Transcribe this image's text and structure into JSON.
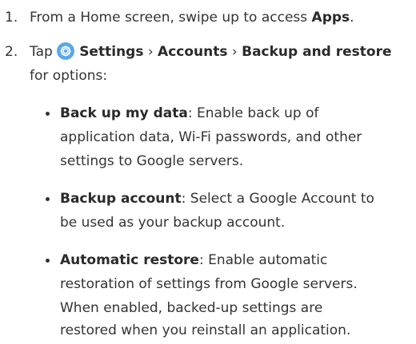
{
  "steps": [
    {
      "number": "1.",
      "text_before": "From a Home screen, swipe up to access ",
      "bold": "Apps",
      "text_after": "."
    },
    {
      "number": "2.",
      "tap": "Tap ",
      "path": [
        {
          "label": "Settings",
          "icon": "settings-gear-icon"
        },
        {
          "label": "Accounts"
        },
        {
          "label": "Backup and restore"
        }
      ],
      "separator": " › ",
      "continuation": "for options:"
    }
  ],
  "bullets": [
    {
      "title": "Back up my data",
      "lines": [
        ": Enable back up of",
        "application data, Wi-Fi passwords, and other",
        "settings to Google servers."
      ]
    },
    {
      "title": "Backup account",
      "lines": [
        ": Select a Google Account to",
        "be used as your backup account."
      ]
    },
    {
      "title": "Automatic restore",
      "lines": [
        ": Enable automatic",
        "restoration of settings from Google servers.",
        "When enabled, backed-up settings are",
        "restored when you reinstall an application."
      ]
    }
  ],
  "colors": {
    "icon_bg": "#5aa7e8",
    "text": "#333333"
  }
}
